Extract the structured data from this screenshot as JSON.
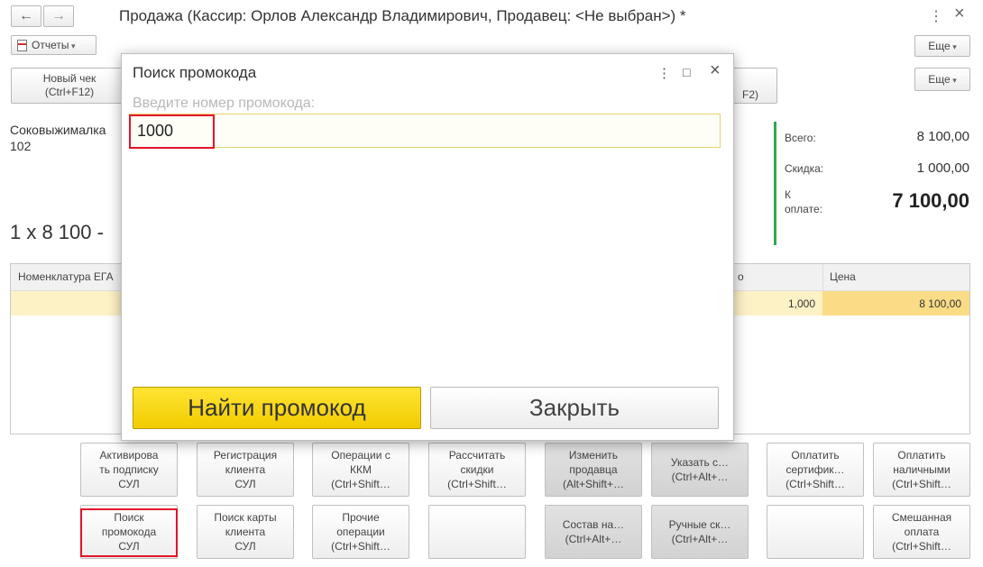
{
  "window": {
    "title": "Продажа (Кассир: Орлов Александр Владимирович, Продавец: <Не выбран>) *",
    "back_icon": "arrow-left-icon",
    "forward_icon": "arrow-right-icon",
    "menu_icon": "⋮",
    "close_icon": "×"
  },
  "toolbar": {
    "reports_label": "Отчеты",
    "more_label": "Еще",
    "more_label_2": "Еще",
    "new_check_label": "Новый чек\n(Ctrl+F12)",
    "f2_fragment": "F2)"
  },
  "product": {
    "name": "Соковыжималка",
    "code": "102",
    "qty_line": "1 x 8 100 -"
  },
  "totals": {
    "total_label": "Всего:",
    "total_value": "8 100,00",
    "discount_label": "Скидка:",
    "discount_value": "1 000,00",
    "to_pay_label": "К\nоплате:",
    "to_pay_value": "7 100,00"
  },
  "table": {
    "headers": [
      "Номенклатура ЕГА",
      "о",
      "Цена"
    ],
    "row": {
      "qty": "1,000",
      "price": "8 100,00"
    }
  },
  "dialog": {
    "title": "Поиск промокода",
    "menu_icon": "⋮",
    "maximize_icon": "□",
    "close_icon": "×",
    "input_placeholder": "Введите номер промокода:",
    "input_value": "1000",
    "find_button": "Найти промокод",
    "close_button": "Закрыть"
  },
  "buttons_row1": [
    "Активирова\nть подписку\nСУЛ",
    "Регистрация\nклиента\nСУЛ",
    "Операции с\nККМ\n(Ctrl+Shift…",
    "Рассчитать\nскидки\n(Ctrl+Shift…",
    "Изменить\nпродавца\n(Alt+Shift+…",
    "Указать с…\n(Ctrl+Alt+…",
    "Оплатить\nсертифик…\n(Ctrl+Shift…",
    "Оплатить\nналичными\n(Ctrl+Shift…"
  ],
  "buttons_row2": [
    "Поиск\nпромокода\nСУЛ",
    "Поиск карты\nклиента\nСУЛ",
    "Прочие\nоперации\n(Ctrl+Shift…",
    "",
    "Состав на…\n(Ctrl+Alt+…",
    "Ручные ск…\n(Ctrl+Alt+…",
    "",
    "Смешанная\nоплата\n(Ctrl+Shift…"
  ],
  "colors": {
    "accent_yellow": "#f5d40f",
    "highlight_row": "#fdf1c6",
    "green_bar": "#2fa84f",
    "red_frame": "#e3142a"
  }
}
